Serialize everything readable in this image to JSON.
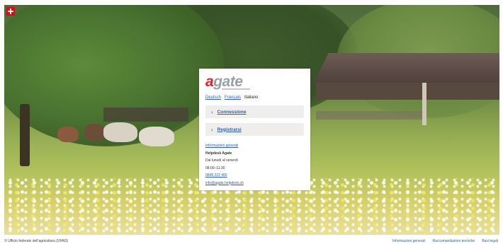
{
  "brand": {
    "logo_text_a": "a",
    "logo_text_rest": "gate",
    "flag_icon": "swiss-flag-icon",
    "accent_color": "#d8262f",
    "link_color": "#2d5fa8"
  },
  "languages": {
    "items": [
      "Deutsch",
      "Français",
      "Italiano"
    ],
    "active": "Italiano"
  },
  "menu": {
    "login_label": "Connessione",
    "register_label": "Registrarsi"
  },
  "info": {
    "general_link": "Informazioni generali",
    "helpdesk_title": "Helpdesk Agate",
    "hours_days": "Dal lunedì al venerdì",
    "hours_time": "08:00–11:30",
    "phone": "0848 222 400",
    "email": "info@agate.helpdesk.ch"
  },
  "footer": {
    "copyright": "© Ufficio federale dell'agricoltura (UFAG)",
    "links": [
      "Informazioni generali",
      "Raccomandazioni tecniche",
      "Basi legali"
    ]
  }
}
